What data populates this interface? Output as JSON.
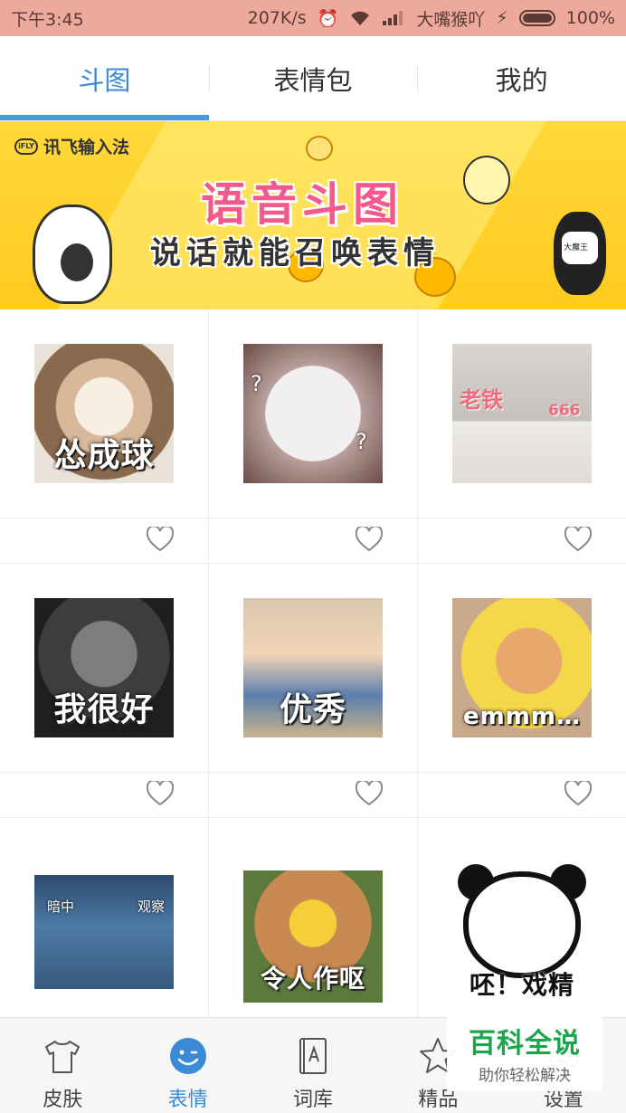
{
  "status_bar": {
    "time": "下午3:45",
    "speed": "207K/s",
    "carrier": "大嘴猴吖",
    "battery": "100%"
  },
  "tabs": [
    {
      "label": "斗图",
      "active": true
    },
    {
      "label": "表情包",
      "active": false
    },
    {
      "label": "我的",
      "active": false
    }
  ],
  "banner": {
    "logo": "讯飞输入法",
    "logo_mark": "iFLY",
    "title": "语音斗图",
    "subtitle": "说话就能召唤表情",
    "mascot_label": "大魔王"
  },
  "stickers": [
    {
      "caption": "怂成球",
      "icon": "cat-photo"
    },
    {
      "caption": "",
      "icon": "white-cat-photo",
      "tags": [
        "?",
        "?"
      ]
    },
    {
      "caption": "",
      "icon": "cats-photo",
      "tags": [
        "老铁",
        "666"
      ]
    },
    {
      "caption": "我很好",
      "icon": "bandaged-cat-photo"
    },
    {
      "caption": "优秀",
      "icon": "anime-boy"
    },
    {
      "caption": "emmm…",
      "icon": "shiba-dog-photo"
    },
    {
      "caption": "",
      "icon": "child-window-photo",
      "tags": [
        "暗中",
        "观察"
      ]
    },
    {
      "caption": "令人作呕",
      "icon": "minion-cat-photo"
    },
    {
      "caption": "呸！戏精",
      "icon": "panda-face"
    }
  ],
  "bottom_nav": [
    {
      "label": "皮肤",
      "icon": "shirt-icon",
      "active": false
    },
    {
      "label": "表情",
      "icon": "smiley-icon",
      "active": true
    },
    {
      "label": "词库",
      "icon": "book-icon",
      "active": false
    },
    {
      "label": "精品",
      "icon": "star-icon",
      "active": false
    },
    {
      "label": "设置",
      "icon": "gear-icon",
      "active": false
    }
  ],
  "watermark": {
    "title": "百科全说",
    "subtitle": "助你轻松解决"
  },
  "colors": {
    "accent": "#3a8ad6",
    "status_bar": "#eda99b",
    "banner": "#ffcb1f"
  }
}
